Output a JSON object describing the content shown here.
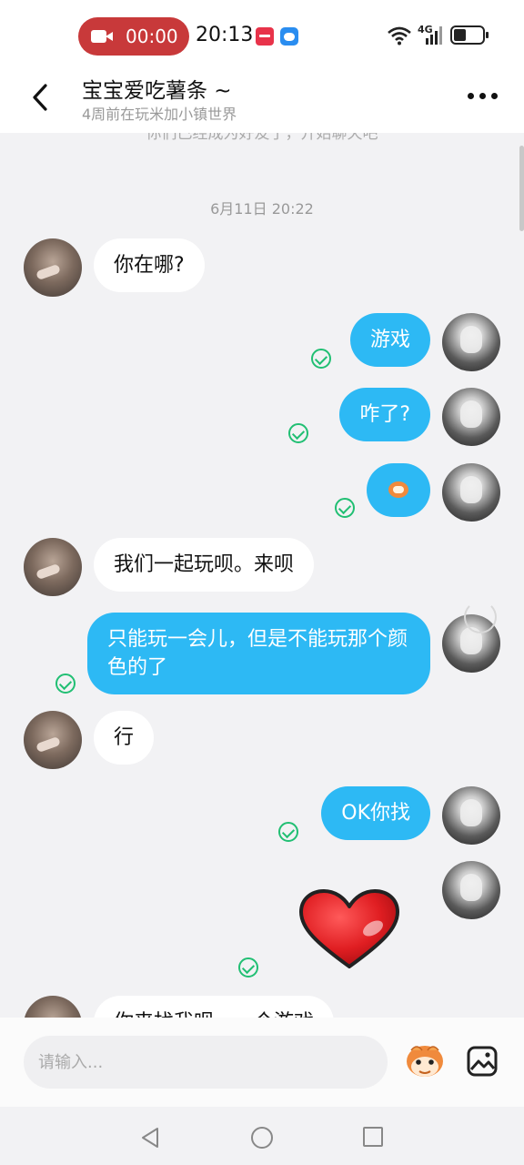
{
  "status_bar": {
    "record_time": "00:00",
    "clock": "20:13",
    "network": "4G",
    "icons": [
      "record-icon",
      "app-notification-icon",
      "weather-icon",
      "wifi-icon",
      "signal-icon",
      "battery-icon"
    ]
  },
  "header": {
    "title": "宝宝爱吃薯条 ~",
    "subtitle": "4周前在玩米加小镇世界",
    "back_icon": "chevron-left-icon",
    "more_icon": "more-horizontal-icon"
  },
  "chat": {
    "system_message": "你们已经成为好友了，开始聊天吧",
    "timestamp": "6月11日 20:22",
    "messages": [
      {
        "side": "left",
        "text": "你在哪?"
      },
      {
        "side": "right",
        "text": "游戏",
        "status": "read"
      },
      {
        "side": "right",
        "text": "咋了?",
        "status": "read"
      },
      {
        "side": "right",
        "text": "",
        "sticker": "monkey-emoji",
        "status": "read"
      },
      {
        "side": "left",
        "text": "我们一起玩呗。来呗"
      },
      {
        "side": "right",
        "text": "只能玩一会儿，但是不能玩那个颜色的了",
        "status": "read"
      },
      {
        "side": "left",
        "text": "行"
      },
      {
        "side": "right",
        "text": "OK你找",
        "status": "read"
      },
      {
        "side": "right",
        "text": "",
        "sticker": "heart-sticker",
        "status": "read"
      },
      {
        "side": "left",
        "text": "你来找我呗，一个游戏"
      }
    ]
  },
  "input": {
    "placeholder": "请输入...",
    "value": "",
    "emoji_button_icon": "monkey-emoji-icon",
    "image_button_icon": "image-icon"
  },
  "nav": {
    "icons": [
      "nav-back-icon",
      "nav-home-icon",
      "nav-recent-icon"
    ]
  },
  "colors": {
    "outgoing_bubble": "#2db9f4",
    "incoming_bubble": "#ffffff",
    "read_check": "#21bf73",
    "record_pill": "#c8393a",
    "background": "#f2f2f4"
  }
}
